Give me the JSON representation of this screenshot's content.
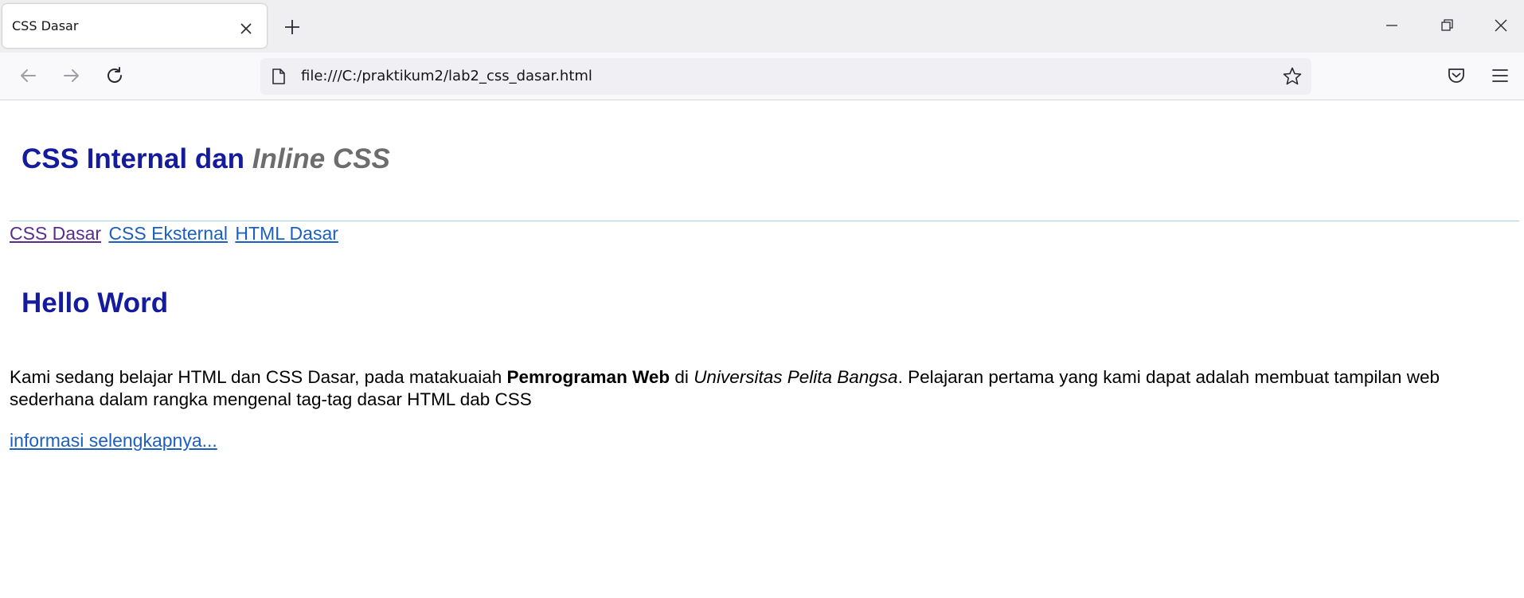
{
  "browser": {
    "tab_title": "CSS Dasar",
    "url": "file:///C:/praktikum2/lab2_css_dasar.html",
    "icons": {
      "close": "close-icon",
      "new_tab": "plus-icon",
      "minimize": "minimize-icon",
      "restore": "restore-icon",
      "window_close": "close-icon",
      "back": "back-arrow-icon",
      "forward": "forward-arrow-icon",
      "reload": "reload-icon",
      "page": "page-icon",
      "bookmark": "star-icon",
      "pocket": "pocket-icon",
      "menu": "hamburger-menu-icon"
    }
  },
  "page": {
    "header": {
      "title_plain": "CSS Internal dan ",
      "title_italic": "Inline CSS"
    },
    "nav": [
      {
        "label": "CSS Dasar",
        "state": "visited"
      },
      {
        "label": "CSS Eksternal",
        "state": "normal"
      },
      {
        "label": "HTML Dasar",
        "state": "normal"
      }
    ],
    "article": {
      "heading": "Hello Word",
      "text_1": "Kami sedang belajar HTML dan CSS Dasar, pada matakuaiah ",
      "bold": "Pemrograman Web",
      "text_2": " di ",
      "italic": "Universitas Pelita Bangsa",
      "text_3": ". Pelajaran pertama yang kami dapat adalah membuat tampilan web sederhana dalam rangka mengenal tag-tag dasar HTML dab CSS",
      "more_link": "informasi selengkapnya..."
    }
  },
  "colors": {
    "heading": "#141b9c",
    "heading_italic": "#6d6d6d",
    "link": "#1b5fc1",
    "link_visited": "#5b2c8e",
    "divider": "#9fd4e8"
  }
}
